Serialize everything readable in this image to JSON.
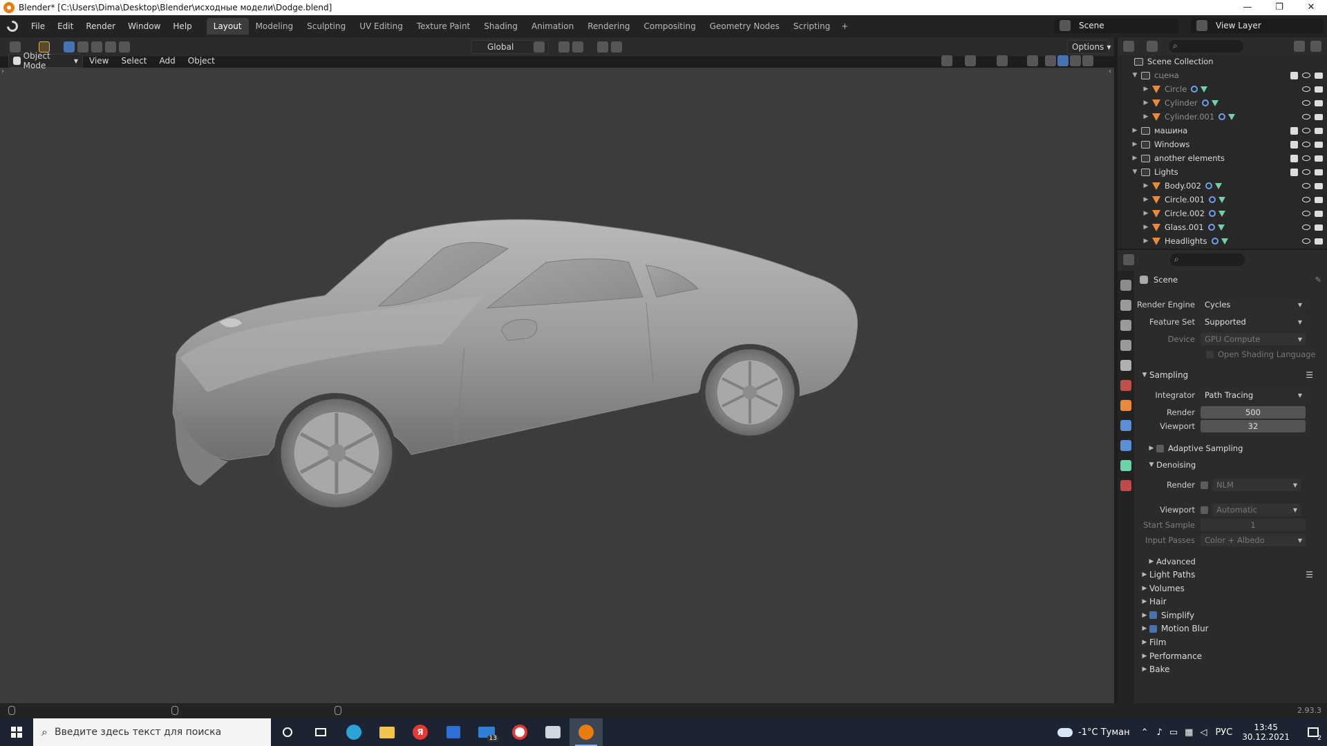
{
  "window": {
    "title": "Blender* [C:\\Users\\Dima\\Desktop\\Blender\\исходные модели\\Dodge.blend]"
  },
  "menu": [
    "File",
    "Edit",
    "Render",
    "Window",
    "Help"
  ],
  "workspaces": [
    "Layout",
    "Modeling",
    "Sculpting",
    "UV Editing",
    "Texture Paint",
    "Shading",
    "Animation",
    "Rendering",
    "Compositing",
    "Geometry Nodes",
    "Scripting"
  ],
  "scene_name": "Scene",
  "view_layer": "View Layer",
  "toolbar": {
    "transform_orientation": "Global",
    "options": "Options"
  },
  "viewport_header": {
    "mode": "Object Mode",
    "menus": [
      "View",
      "Select",
      "Add",
      "Object"
    ]
  },
  "outliner": {
    "root": "Scene Collection",
    "rows": [
      {
        "name": "сцена",
        "kind": "collection",
        "level": 0,
        "dim": true
      },
      {
        "name": "Circle",
        "kind": "mesh",
        "level": 1,
        "dim": true
      },
      {
        "name": "Cylinder",
        "kind": "mesh",
        "level": 1,
        "dim": true
      },
      {
        "name": "Cylinder.001",
        "kind": "mesh",
        "level": 1,
        "dim": true
      },
      {
        "name": "машина",
        "kind": "collection",
        "level": 0,
        "dim": false
      },
      {
        "name": "Windows",
        "kind": "collection",
        "level": 0,
        "dim": false
      },
      {
        "name": "another elements",
        "kind": "collection",
        "level": 0,
        "dim": false
      },
      {
        "name": "Lights",
        "kind": "collection",
        "level": 0,
        "dim": false
      },
      {
        "name": "Body.002",
        "kind": "mesh",
        "level": 1,
        "dim": false
      },
      {
        "name": "Circle.001",
        "kind": "mesh",
        "level": 1,
        "dim": false
      },
      {
        "name": "Circle.002",
        "kind": "mesh",
        "level": 1,
        "dim": false
      },
      {
        "name": "Glass.001",
        "kind": "mesh",
        "level": 1,
        "dim": false
      },
      {
        "name": "Headlights",
        "kind": "mesh",
        "level": 1,
        "dim": false
      }
    ]
  },
  "properties": {
    "context": "Scene",
    "render_engine_label": "Render Engine",
    "render_engine": "Cycles",
    "feature_set_label": "Feature Set",
    "feature_set": "Supported",
    "device_label": "Device",
    "device": "GPU Compute",
    "osl": "Open Shading Language",
    "sampling": "Sampling",
    "integrator_label": "Integrator",
    "integrator": "Path Tracing",
    "render_label": "Render",
    "render_samples": "500",
    "viewport_label": "Viewport",
    "viewport_samples": "32",
    "adaptive_sampling": "Adaptive Sampling",
    "denoising": "Denoising",
    "denoise_render_label": "Render",
    "denoise_render_value": "NLM",
    "denoise_viewport_label": "Viewport",
    "denoise_viewport_value": "Automatic",
    "start_sample_label": "Start Sample",
    "start_sample": "1",
    "input_passes_label": "Input Passes",
    "input_passes": "Color + Albedo",
    "advanced": "Advanced",
    "panels": [
      {
        "label": "Light Paths",
        "checkbox": false
      },
      {
        "label": "Volumes",
        "checkbox": false
      },
      {
        "label": "Hair",
        "checkbox": false
      },
      {
        "label": "Simplify",
        "checkbox": true
      },
      {
        "label": "Motion Blur",
        "checkbox": true
      },
      {
        "label": "Film",
        "checkbox": false
      },
      {
        "label": "Performance",
        "checkbox": false
      },
      {
        "label": "Bake",
        "checkbox": false
      }
    ]
  },
  "status": {
    "version": "2.93.3"
  },
  "taskbar": {
    "search_placeholder": "Введите здесь текст для поиска",
    "weather": "-1°C  Туман",
    "lang": "РУС",
    "time": "13:45",
    "date": "30.12.2021",
    "mail_badge": "13",
    "notif_badge": "2"
  },
  "colors": {
    "accent": "#4772b3",
    "orange": "#e87d0d",
    "mesh": "#e88a3a",
    "geom": "#6fd1a7"
  }
}
